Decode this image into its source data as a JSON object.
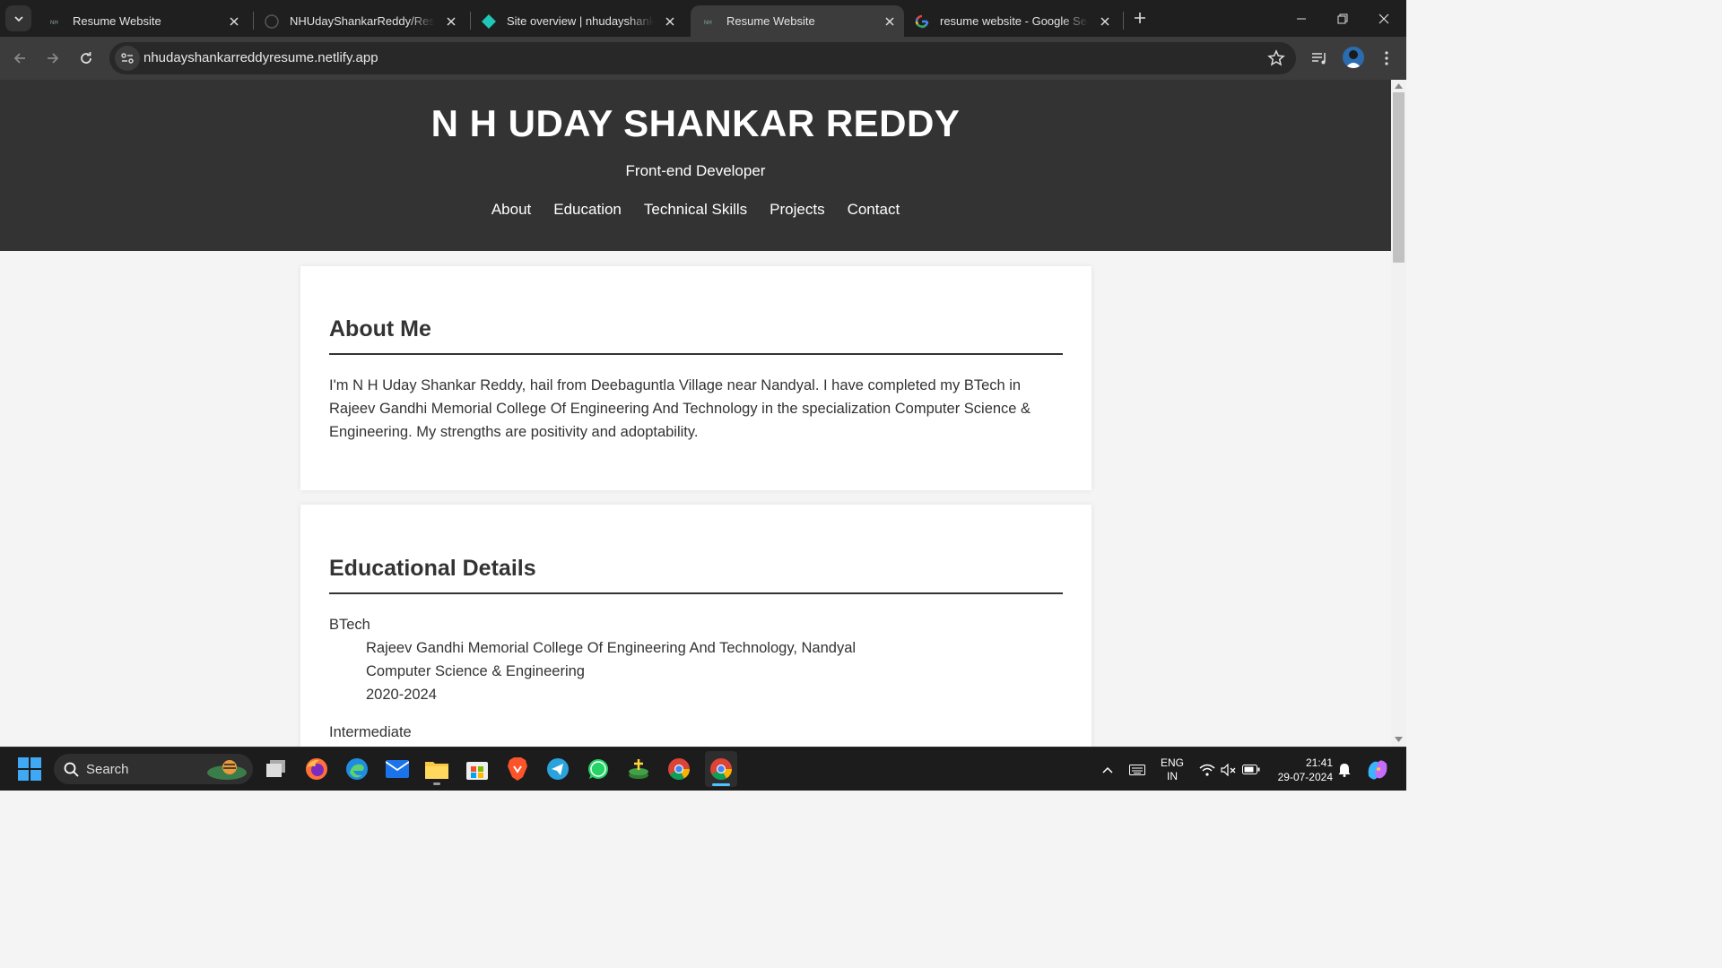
{
  "browser": {
    "tabs": [
      {
        "title": "Resume Website",
        "icon": "netlify-resume-favicon",
        "active": false
      },
      {
        "title": "NHUdayShankarReddy/Resume",
        "icon": "github-icon",
        "active": false
      },
      {
        "title": "Site overview | nhudayshankarreddyresume",
        "icon": "netlify-icon",
        "active": false
      },
      {
        "title": "Resume Website",
        "icon": "netlify-resume-favicon",
        "active": true
      },
      {
        "title": "resume website - Google Search",
        "icon": "google-icon",
        "active": false
      }
    ],
    "url": "nhudayshankarreddyresume.netlify.app"
  },
  "site": {
    "name": "N H UDAY SHANKAR REDDY",
    "role": "Front-end Developer",
    "nav": [
      "About",
      "Education",
      "Technical Skills",
      "Projects",
      "Contact"
    ]
  },
  "about": {
    "heading": "About Me",
    "text": "I'm N H Uday Shankar Reddy, hail from Deebaguntla Village near Nandyal. I have completed my BTech in Rajeev Gandhi Memorial College Of Engineering And Technology in the specialization Computer Science & Engineering. My strengths are positivity and adoptability."
  },
  "education": {
    "heading": "Educational Details",
    "items": [
      {
        "degree": "BTech",
        "college": "Rajeev Gandhi Memorial College Of Engineering And Technology, Nandyal",
        "branch": "Computer Science & Engineering",
        "years": "2020-2024"
      },
      {
        "degree": "Intermediate"
      }
    ]
  },
  "taskbar": {
    "search_label": "Search",
    "language_line1": "ENG",
    "language_line2": "IN",
    "time": "21:41",
    "date": "29-07-2024"
  },
  "colors": {
    "header_bg": "#333333",
    "page_bg": "#f4f4f4",
    "card_bg": "#ffffff",
    "chrome_dark": "#1f1f1f",
    "chrome_toolbar": "#3c3c3c"
  }
}
